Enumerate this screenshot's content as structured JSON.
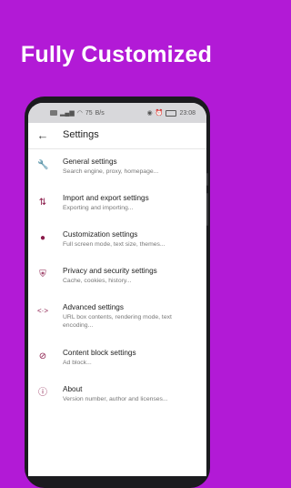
{
  "promo": {
    "headline": "Fully Customized"
  },
  "status_bar": {
    "time": "23:08",
    "net_a": "75",
    "net_b": "B/s"
  },
  "app_bar": {
    "title": "Settings"
  },
  "items": [
    {
      "title": "General settings",
      "subtitle": "Search engine, proxy, homepage...",
      "icon": "wrench-icon"
    },
    {
      "title": "Import and export settings",
      "subtitle": "Exporting and importing...",
      "icon": "swap-icon"
    },
    {
      "title": "Customization settings",
      "subtitle": "Full screen mode, text size, themes...",
      "icon": "palette-icon"
    },
    {
      "title": "Privacy and security settings",
      "subtitle": "Cache, cookies, history...",
      "icon": "shield-icon"
    },
    {
      "title": "Advanced settings",
      "subtitle": "URL box contents, rendering mode, text encoding...",
      "icon": "code-icon"
    },
    {
      "title": "Content block settings",
      "subtitle": "Ad block...",
      "icon": "block-icon"
    },
    {
      "title": "About",
      "subtitle": "Version number, author and licenses...",
      "icon": "info-icon"
    }
  ],
  "colors": {
    "background": "#b21ad6",
    "icon": "#8a1b4a"
  }
}
